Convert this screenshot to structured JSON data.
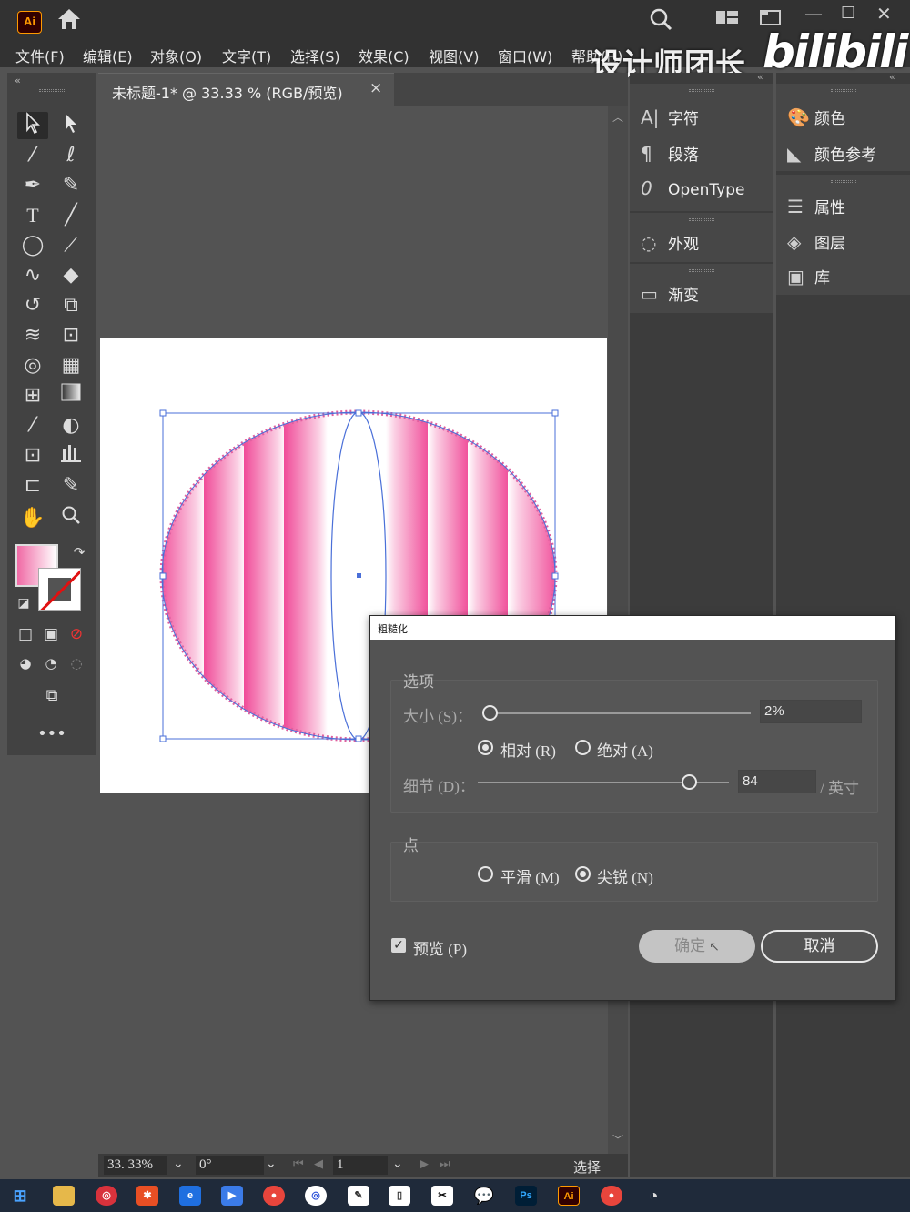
{
  "app": {
    "logo_text": "Ai",
    "watermark_cn": "设计师团长",
    "watermark_brand": "bilibili"
  },
  "menu": [
    "文件(F)",
    "编辑(E)",
    "对象(O)",
    "文字(T)",
    "选择(S)",
    "效果(C)",
    "视图(V)",
    "窗口(W)",
    "帮助(H)"
  ],
  "document_tab": {
    "title": "未标题-1* @ 33.33 % (RGB/预览)",
    "close": "×"
  },
  "panels_col1": [
    {
      "icon": "character-icon",
      "label": "字符"
    },
    {
      "icon": "paragraph-icon",
      "label": "段落"
    },
    {
      "icon": "opentype-icon",
      "label": "OpenType"
    },
    {
      "icon": "appearance-icon",
      "label": "外观"
    },
    {
      "icon": "gradient-icon",
      "label": "渐变"
    }
  ],
  "panels_col2": [
    {
      "icon": "color-icon",
      "label": "颜色"
    },
    {
      "icon": "color-guide-icon",
      "label": "颜色参考"
    },
    {
      "icon": "properties-icon",
      "label": "属性"
    },
    {
      "icon": "layers-icon",
      "label": "图层"
    },
    {
      "icon": "libraries-icon",
      "label": "库"
    }
  ],
  "statusbar": {
    "zoom": "33. 33%",
    "rotation": "0°",
    "artboard": "1",
    "tool": "选择"
  },
  "dialog": {
    "title": "粗糙化",
    "options_legend": "选项",
    "size_label": "大小 (S)：",
    "size_value": "2%",
    "size_fraction": 0.0,
    "relative_label": "相对 (R)",
    "absolute_label": "绝对 (A)",
    "relative_checked": true,
    "detail_label": "细节 (D)：",
    "detail_value": "84",
    "detail_fraction": 0.84,
    "detail_unit": "/ 英寸",
    "points_legend": "点",
    "smooth_label": "平滑 (M)",
    "corner_label": "尖锐 (N)",
    "corner_checked": true,
    "preview_label": "预览 (P)",
    "preview_checked": true,
    "ok_label": "确定",
    "cancel_label": "取消"
  },
  "colors": {
    "fill_gradient_start": "#f06aa5",
    "fill_gradient_end": "#ffffff",
    "selection": "#4a6fd8",
    "accent_ai": "#ff9a00"
  }
}
